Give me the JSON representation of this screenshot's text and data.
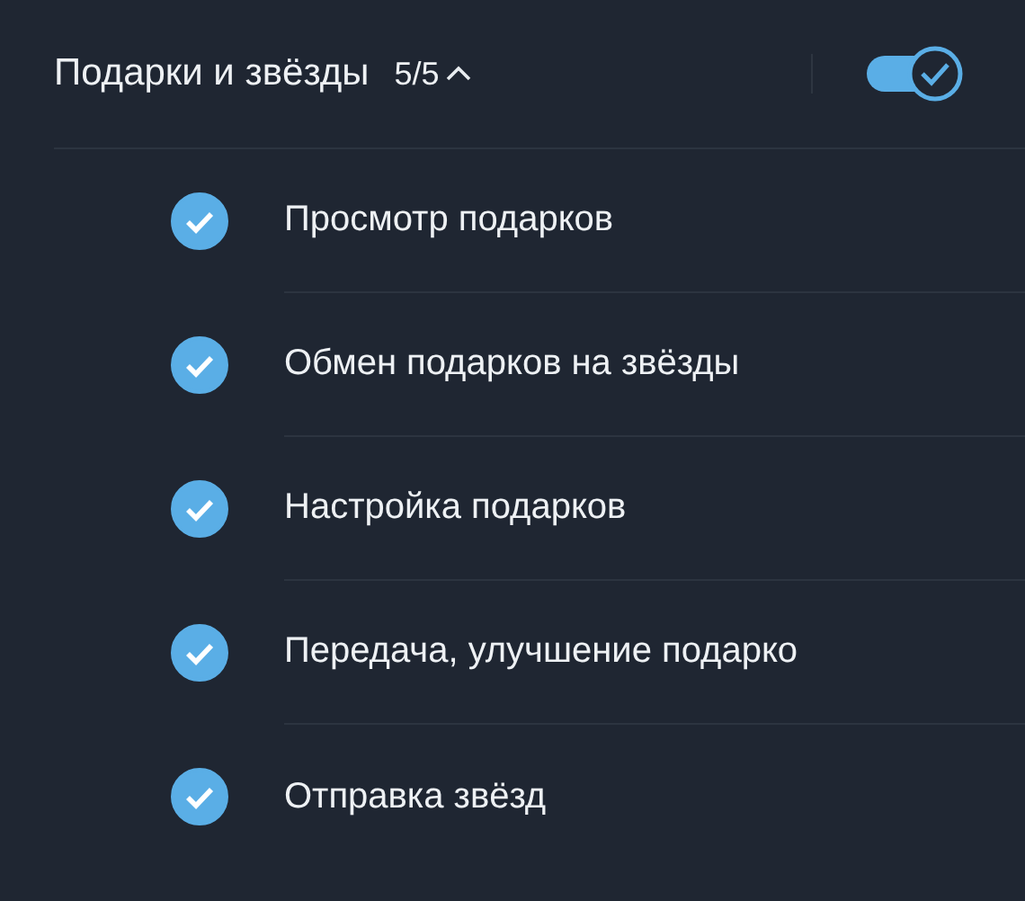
{
  "header": {
    "title": "Подарки и звёзды",
    "count": "5/5",
    "expanded": true,
    "toggle_on": true
  },
  "items": [
    {
      "label": "Просмотр подарков",
      "checked": true
    },
    {
      "label": "Обмен подарков на звёзды",
      "checked": true
    },
    {
      "label": "Настройка подарков",
      "checked": true
    },
    {
      "label": "Передача, улучшение подарко",
      "checked": true
    },
    {
      "label": "Отправка звёзд",
      "checked": true
    }
  ]
}
